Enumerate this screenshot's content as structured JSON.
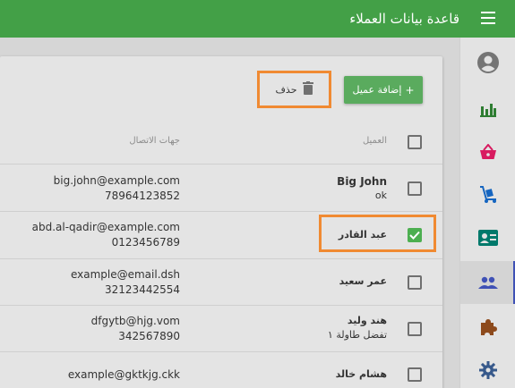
{
  "app": {
    "title": "قاعدة بيانات العملاء"
  },
  "toolbar": {
    "add_label": "إضافة عميل",
    "add_icon": "+",
    "delete_label": "حذف"
  },
  "table": {
    "headers": {
      "customer": "العميل",
      "contacts": "جهات الاتصال"
    },
    "rows": [
      {
        "name": "Big John",
        "note": "ok",
        "email": "big.john@example.com",
        "phone": "78964123852",
        "selected": false
      },
      {
        "name": "عبد القادر",
        "note": "",
        "email": "abd.al-qadir@example.com",
        "phone": "0123456789",
        "selected": true
      },
      {
        "name": "عمر سعيد",
        "note": "",
        "email": "example@email.dsh",
        "phone": "32123442554",
        "selected": false
      },
      {
        "name": "هند وليد",
        "note": "تفضل طاولة ١",
        "email": "dfgytb@hjg.vom",
        "phone": "342567890",
        "selected": false
      },
      {
        "name": "هشام خالد",
        "note": "",
        "email": "example@gktkjg.ckk",
        "phone": "",
        "selected": false
      }
    ]
  },
  "nav": {
    "items": [
      "account-circle-icon",
      "bar-chart-icon",
      "shopping-basket-icon",
      "dolly-cart-icon",
      "contact-card-icon",
      "people-icon",
      "puzzle-icon",
      "gear-icon"
    ],
    "active": "people-icon"
  },
  "colors": {
    "appbar": "#43a047",
    "add_button": "#5aab5e",
    "highlight": "#f08a32",
    "checked": "#4caf50",
    "active_nav": "#3f51b5"
  }
}
